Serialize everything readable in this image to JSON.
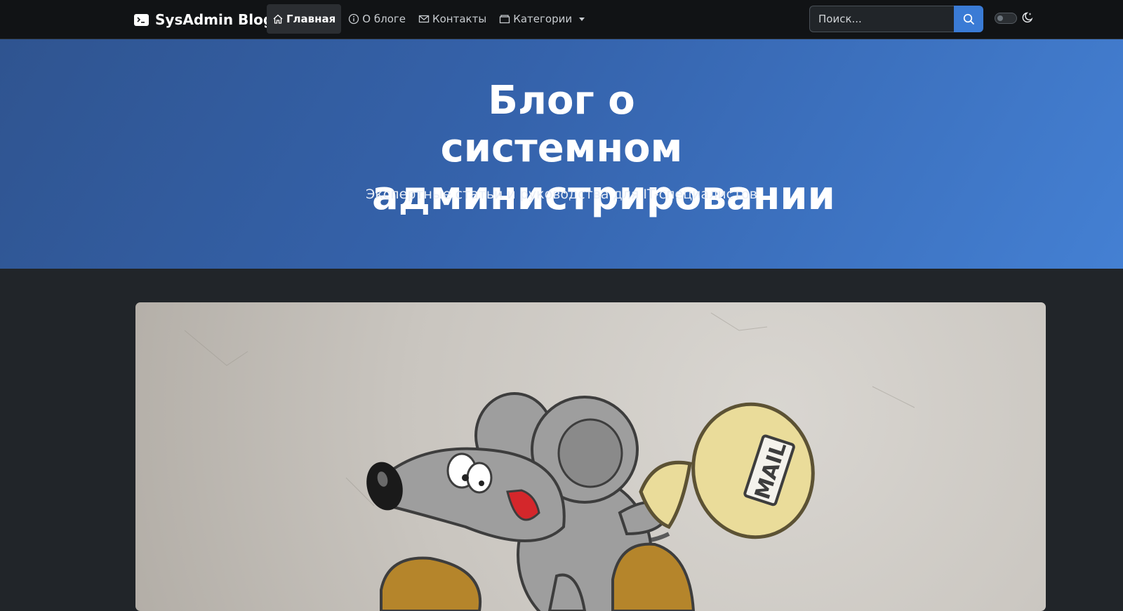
{
  "navbar": {
    "brand": "SysAdmin Blog",
    "brand_icon": "terminal-icon",
    "items": [
      {
        "label": "Главная",
        "icon": "house-icon",
        "active": true
      },
      {
        "label": "О блоге",
        "icon": "info-circle-icon",
        "active": false
      },
      {
        "label": "Контакты",
        "icon": "envelope-icon",
        "active": false
      },
      {
        "label": "Категории",
        "icon": "folder-icon",
        "active": false,
        "dropdown": true
      }
    ],
    "search": {
      "placeholder": "Поиск...",
      "icon": "search-icon"
    },
    "theme_toggle": {
      "icon": "moon-stars-icon",
      "state": "off"
    }
  },
  "hero": {
    "title": "Блог о системном администрировании",
    "subtitle": "Экспертные статьи и руководства для IT-специалистов"
  },
  "featured_post": {
    "image_text": "MAIL"
  },
  "colors": {
    "navbar_bg": "#111315",
    "hero_gradient_start": "#2f5490",
    "hero_gradient_end": "#4480d3",
    "page_bg": "#212529",
    "accent": "#3a7bd5"
  }
}
